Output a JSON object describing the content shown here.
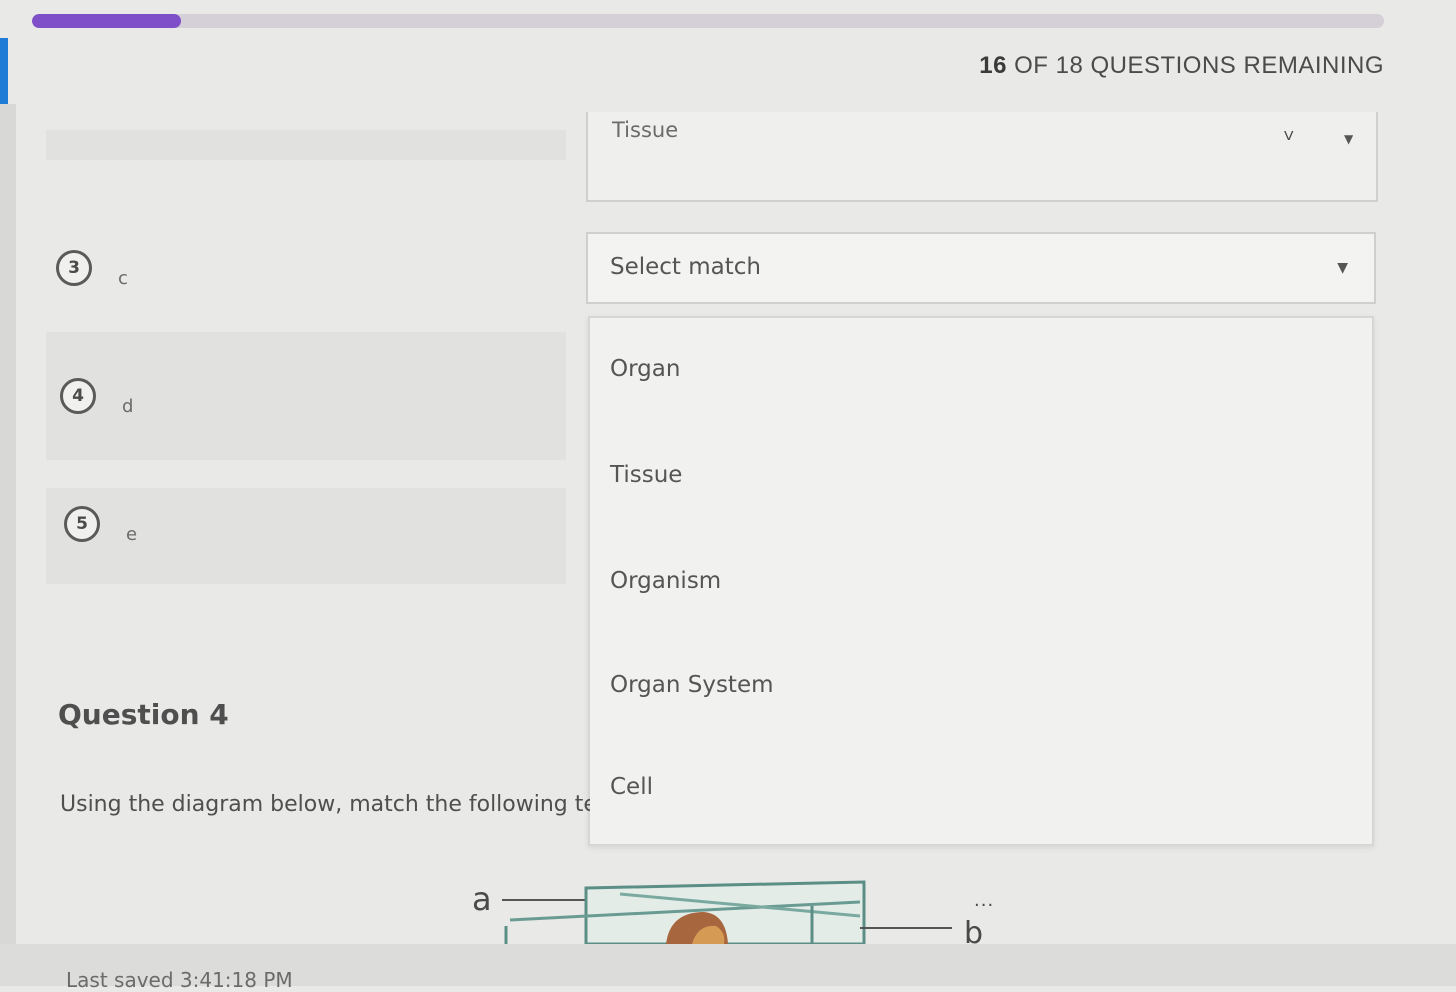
{
  "progress": {
    "value_percent": 11,
    "remaining_text": "16 OF 18 QUESTIONS REMAINING",
    "remaining_count": "16",
    "remaining_rest": " OF 18 QUESTIONS REMAINING"
  },
  "prev_select": {
    "value": "Tissue"
  },
  "match_items": [
    {
      "number": "3",
      "letter": "c",
      "select_placeholder": "Select match"
    },
    {
      "number": "4",
      "letter": "d"
    },
    {
      "number": "5",
      "letter": "e"
    }
  ],
  "dropdown": {
    "options": [
      "Organ",
      "Tissue",
      "Organism",
      "Organ System",
      "Cell"
    ]
  },
  "question": {
    "title": "Question 4",
    "instruction": "Using the diagram below, match the following te"
  },
  "diagram": {
    "label_a": "a",
    "label_b": "b",
    "more": "..."
  },
  "footer": {
    "last_saved": "Last saved 3:41:18 PM"
  },
  "colors": {
    "accent": "#7e4fc9",
    "left_accent": "#1e7bd6"
  }
}
